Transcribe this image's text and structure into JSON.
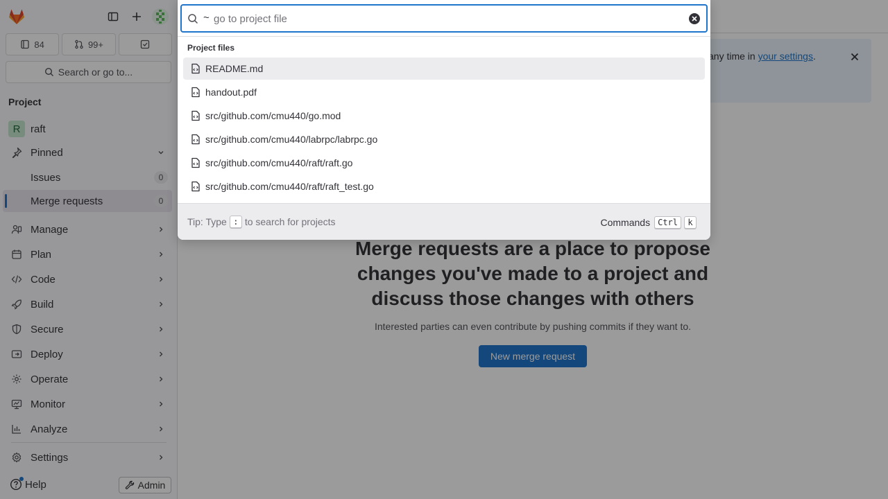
{
  "sidebar": {
    "counters": {
      "issues": "84",
      "merge_requests": "99+"
    },
    "search_label": "Search or go to...",
    "section_title": "Project",
    "project_name": "raft",
    "project_initial": "R",
    "pinned_label": "Pinned",
    "pinned_items": [
      {
        "label": "Issues",
        "count": "0"
      },
      {
        "label": "Merge requests",
        "count": "0"
      }
    ],
    "nav": [
      {
        "label": "Manage",
        "icon": "users-icon"
      },
      {
        "label": "Plan",
        "icon": "calendar-icon"
      },
      {
        "label": "Code",
        "icon": "code-icon"
      },
      {
        "label": "Build",
        "icon": "rocket-icon"
      },
      {
        "label": "Secure",
        "icon": "shield-icon"
      },
      {
        "label": "Deploy",
        "icon": "deploy-icon"
      },
      {
        "label": "Operate",
        "icon": "cloud-gear-icon"
      },
      {
        "label": "Monitor",
        "icon": "monitor-icon"
      },
      {
        "label": "Analyze",
        "icon": "chart-icon"
      }
    ],
    "settings_label": "Settings",
    "help_label": "Help",
    "admin_label": "Admin"
  },
  "main": {
    "alert_text_prefix": "any time in ",
    "alert_link": "your settings",
    "alert_suffix": ".",
    "empty_title": "Merge requests are a place to propose changes you've made to a project and discuss those changes with others",
    "empty_desc": "Interested parties can even contribute by pushing commits if they want to.",
    "new_mr_button": "New merge request"
  },
  "modal": {
    "search_prefix": "~",
    "search_placeholder": "go to project file",
    "group_label": "Project files",
    "files": [
      "README.md",
      "handout.pdf",
      "src/github.com/cmu440/go.mod",
      "src/github.com/cmu440/labrpc/labrpc.go",
      "src/github.com/cmu440/raft/raft.go",
      "src/github.com/cmu440/raft/raft_test.go"
    ],
    "tip_prefix": "Tip: Type",
    "tip_key": ":",
    "tip_suffix": "to search for projects",
    "commands_label": "Commands",
    "commands_keys": [
      "Ctrl",
      "k"
    ]
  },
  "colors": {
    "accent": "#1f75cb",
    "logo_orange": "#e24329"
  }
}
